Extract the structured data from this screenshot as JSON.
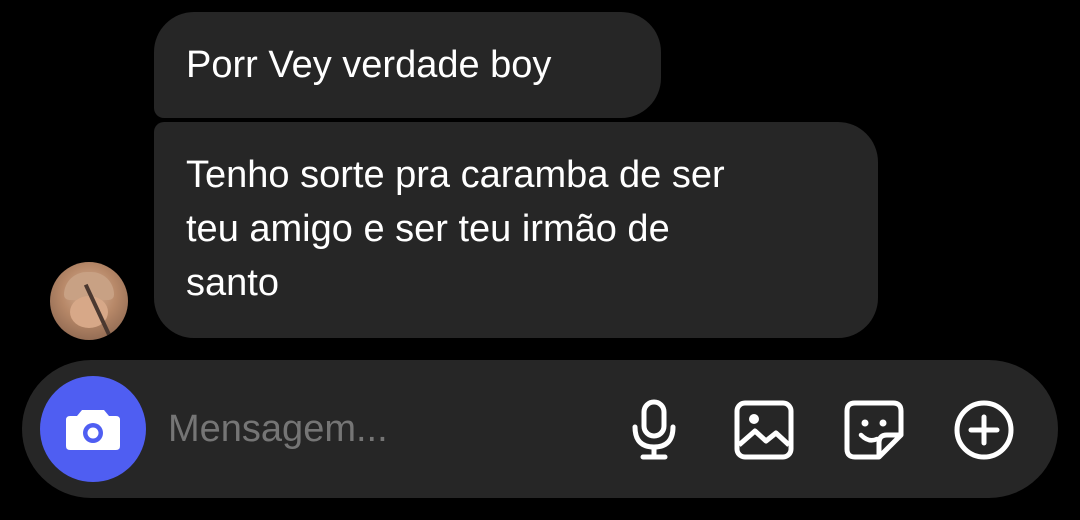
{
  "messages": [
    {
      "sender": "other",
      "text": "Porr Vey verdade boy"
    },
    {
      "sender": "other",
      "lines": [
        "Tenho sorte pra caramba de ser",
        "teu amigo e ser teu irmão de",
        "santo"
      ]
    }
  ],
  "composer": {
    "placeholder": "Mensagem...",
    "buttons": {
      "camera": "camera-icon",
      "mic": "microphone-icon",
      "gallery": "image-icon",
      "sticker": "sticker-icon",
      "more": "plus-circle-icon"
    }
  },
  "colors": {
    "background": "#000000",
    "bubble": "#262626",
    "composer": "#262626",
    "camera_button": "#4f5ef2",
    "placeholder": "#8e8e8e",
    "text": "#ffffff"
  }
}
